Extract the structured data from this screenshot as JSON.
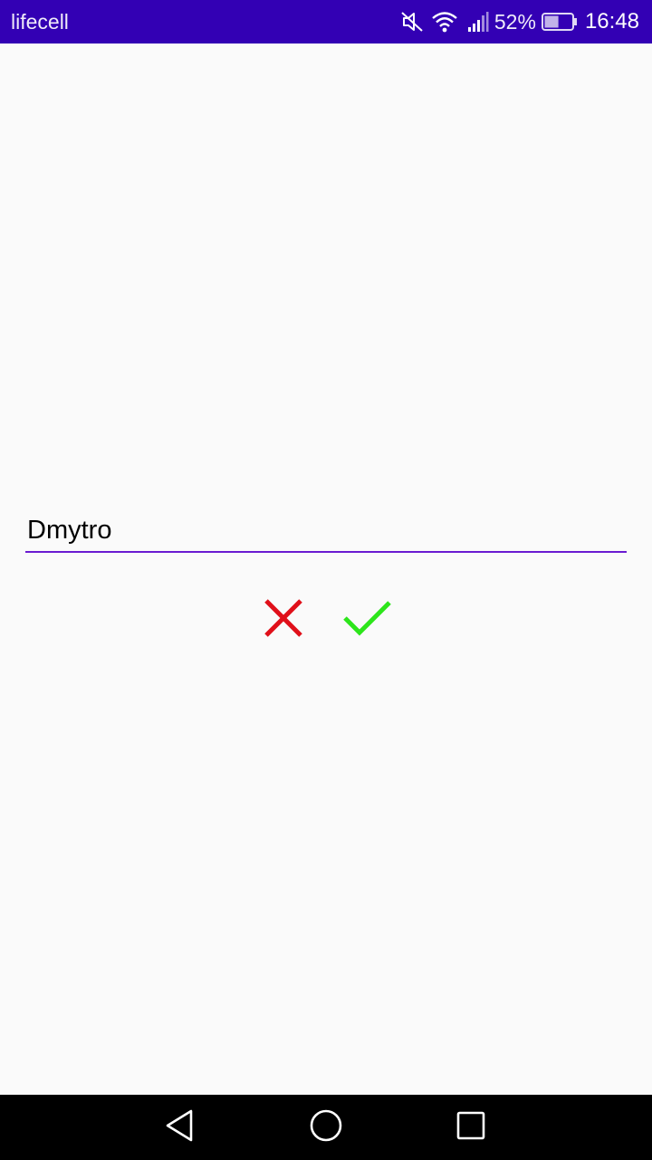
{
  "colors": {
    "status_bar": "#3300b4",
    "background": "#fafafa",
    "accent": "#6a1bd1",
    "cancel": "#e0101a",
    "confirm": "#2de51b",
    "nav_bar": "#000000"
  },
  "status_bar": {
    "carrier": "lifecell",
    "battery_percent": "52%",
    "battery_level": 0.52,
    "time": "16:48",
    "icons": [
      "muted-icon",
      "wifi-icon",
      "signal-icon",
      "battery-icon"
    ]
  },
  "name_field": {
    "value": "Dmytro"
  },
  "actions": {
    "cancel_icon": "close-icon",
    "confirm_icon": "check-icon"
  },
  "nav_bar": {
    "icons": [
      "back-icon",
      "home-icon",
      "recents-icon"
    ]
  }
}
